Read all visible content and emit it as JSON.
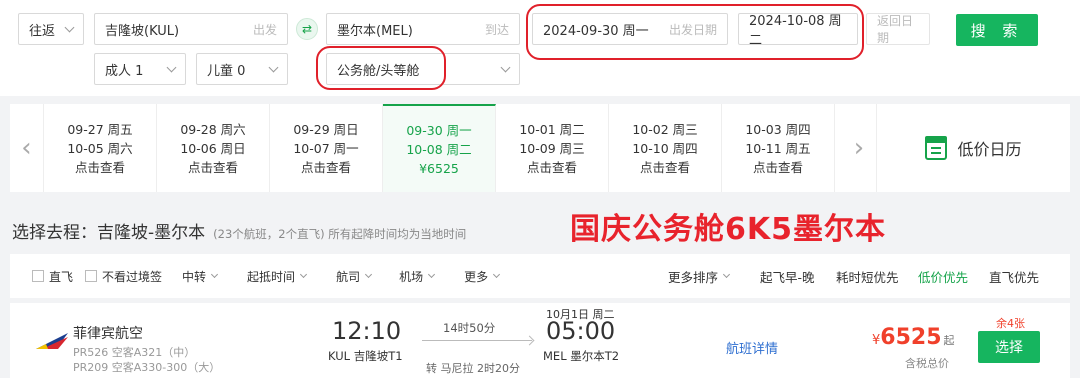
{
  "search": {
    "trip_type": "往返",
    "from_value": "吉隆坡(KUL)",
    "from_label": "出发",
    "to_value": "墨尔本(MEL)",
    "to_label": "到达",
    "depart_date": "2024-09-30 周一",
    "depart_label": "出发日期",
    "return_date": "2024-10-08 周二",
    "return_label": "返回日期",
    "search_label": "搜 索",
    "adults": "成人 1",
    "children": "儿童 0",
    "cabin": "公务舱/头等舱"
  },
  "dates": [
    {
      "d1": "09-27 周五",
      "d2": "10-05 周六",
      "d3": "点击查看"
    },
    {
      "d1": "09-28 周六",
      "d2": "10-06 周日",
      "d3": "点击查看"
    },
    {
      "d1": "09-29 周日",
      "d2": "10-07 周一",
      "d3": "点击查看"
    },
    {
      "d1": "09-30 周一",
      "d2": "10-08 周二",
      "d3": "¥6525"
    },
    {
      "d1": "10-01 周二",
      "d2": "10-09 周三",
      "d3": "点击查看"
    },
    {
      "d1": "10-02 周三",
      "d2": "10-10 周四",
      "d3": "点击查看"
    },
    {
      "d1": "10-03 周四",
      "d2": "10-11 周五",
      "d3": "点击查看"
    }
  ],
  "calendar_label": "低价日历",
  "route_title": "选择去程：吉隆坡-墨尔本",
  "route_info": "(23个航班，2个直飞) 所有起降时间均为当地时间",
  "promo_text": "国庆公务舱6K5墨尔本",
  "filters": {
    "direct": "直飞",
    "no_transit_visa": "不看过境签",
    "transfer": "中转",
    "times": "起抵时间",
    "airline": "航司",
    "airport": "机场",
    "more": "更多",
    "more_sort": "更多排序",
    "sort_early": "起飞早-晚",
    "sort_short": "耗时短优先",
    "sort_low": "低价优先",
    "sort_direct": "直飞优先"
  },
  "flight": {
    "airline": "菲律宾航空",
    "leg1": "PR526 空客A321（中）",
    "leg2": "PR209 空客A330-300（大）",
    "dep_time": "12:10",
    "dep_airport": "KUL 吉隆坡T1",
    "duration": "14时50分",
    "stopover": "转 马尼拉 2时20分",
    "arr_date": "10月1日 周二",
    "arr_time": "05:00",
    "arr_airport": "MEL 墨尔本T2",
    "detail": "航班详情",
    "currency": "¥",
    "price": "6525",
    "price_suffix": "起",
    "tax_note": "含税总价",
    "remaining": "余4张",
    "select_label": "选择"
  },
  "colors": {
    "accent": "#16b55f",
    "highlight": "#e0202a",
    "price": "#f0402b",
    "link": "#2f6fd0"
  }
}
